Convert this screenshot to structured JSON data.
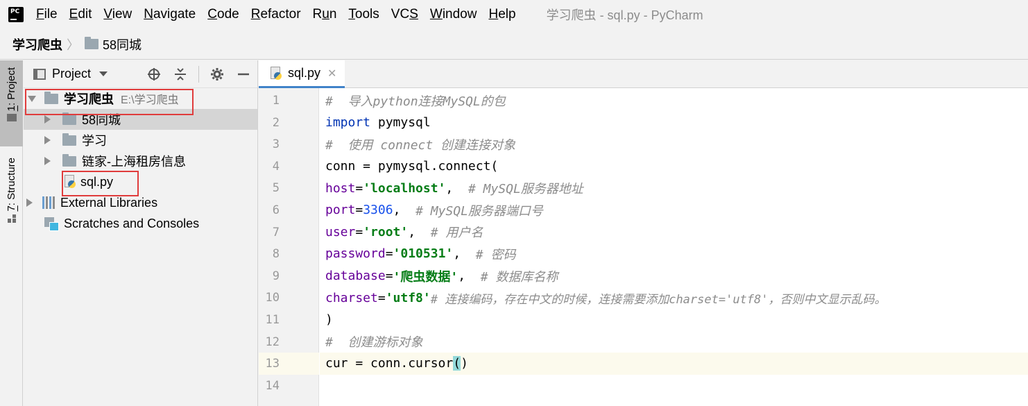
{
  "app": {
    "window_title": "学习爬虫 - sql.py - PyCharm",
    "menu": [
      {
        "pre": "",
        "u": "F",
        "post": "ile"
      },
      {
        "pre": "",
        "u": "E",
        "post": "dit"
      },
      {
        "pre": "",
        "u": "V",
        "post": "iew"
      },
      {
        "pre": "",
        "u": "N",
        "post": "avigate"
      },
      {
        "pre": "",
        "u": "C",
        "post": "ode"
      },
      {
        "pre": "",
        "u": "R",
        "post": "efactor"
      },
      {
        "pre": "R",
        "u": "u",
        "post": "n"
      },
      {
        "pre": "",
        "u": "T",
        "post": "ools"
      },
      {
        "pre": "VC",
        "u": "S",
        "post": ""
      },
      {
        "pre": "",
        "u": "W",
        "post": "indow"
      },
      {
        "pre": "",
        "u": "H",
        "post": "elp"
      }
    ]
  },
  "breadcrumb": {
    "root": "学习爬虫",
    "child": "58同城"
  },
  "toolstrip": {
    "project_tab": {
      "u": "1",
      "rest": ": Project"
    },
    "structure_tab": {
      "u": "7",
      "rest": ": Structure"
    }
  },
  "project_panel": {
    "title": "Project",
    "tree": {
      "root_label": "学习爬虫",
      "root_path": "E:\\学习爬虫",
      "folder_1": "58同城",
      "folder_2": "学习",
      "folder_3": "链家-上海租房信息",
      "file_1": "sql.py",
      "external": "External Libraries",
      "scratches": "Scratches and Consoles"
    }
  },
  "editor": {
    "tab_label": "sql.py",
    "current_line": 13,
    "line_numbers": [
      "1",
      "2",
      "3",
      "4",
      "5",
      "6",
      "7",
      "8",
      "9",
      "10",
      "11",
      "12",
      "13",
      "14"
    ],
    "code": {
      "l1": "#  导入python连接MySQL的包",
      "l2_kw": "import",
      "l2_rest": " pymysql",
      "l3": "#  使用 connect 创建连接对象",
      "l4": "conn = pymysql.connect(",
      "l5_key": "host",
      "l5_val": "'localhost'",
      "l5_cm": "# MySQL服务器地址",
      "l6_key": "port",
      "l6_val": "3306",
      "l6_cm": "# MySQL服务器端口号",
      "l7_key": "user",
      "l7_val": "'root'",
      "l7_cm": "# 用户名",
      "l8_key": "password",
      "l8_val": "'010531'",
      "l8_cm": "# 密码",
      "l9_key": "database",
      "l9_val": "'爬虫数据'",
      "l9_cm": "# 数据库名称",
      "l10_key": "charset",
      "l10_val": "'utf8'",
      "l10_cm": "# 连接编码，存在中文的时候，连接需要添加charset='utf8'，否则中文显示乱码。",
      "l11": ")",
      "l12": "#  创建游标对象",
      "l13_pre": "cur = conn.cursor",
      "l13_paren_open": "(",
      "l13_paren_close": ")",
      "l14": ""
    }
  },
  "colors": {
    "keyword": "#0033b3",
    "string": "#067d17",
    "number": "#1750eb",
    "kwarg": "#660099",
    "comment": "#8c8c8c",
    "highlight_box": "#e03c3c"
  }
}
